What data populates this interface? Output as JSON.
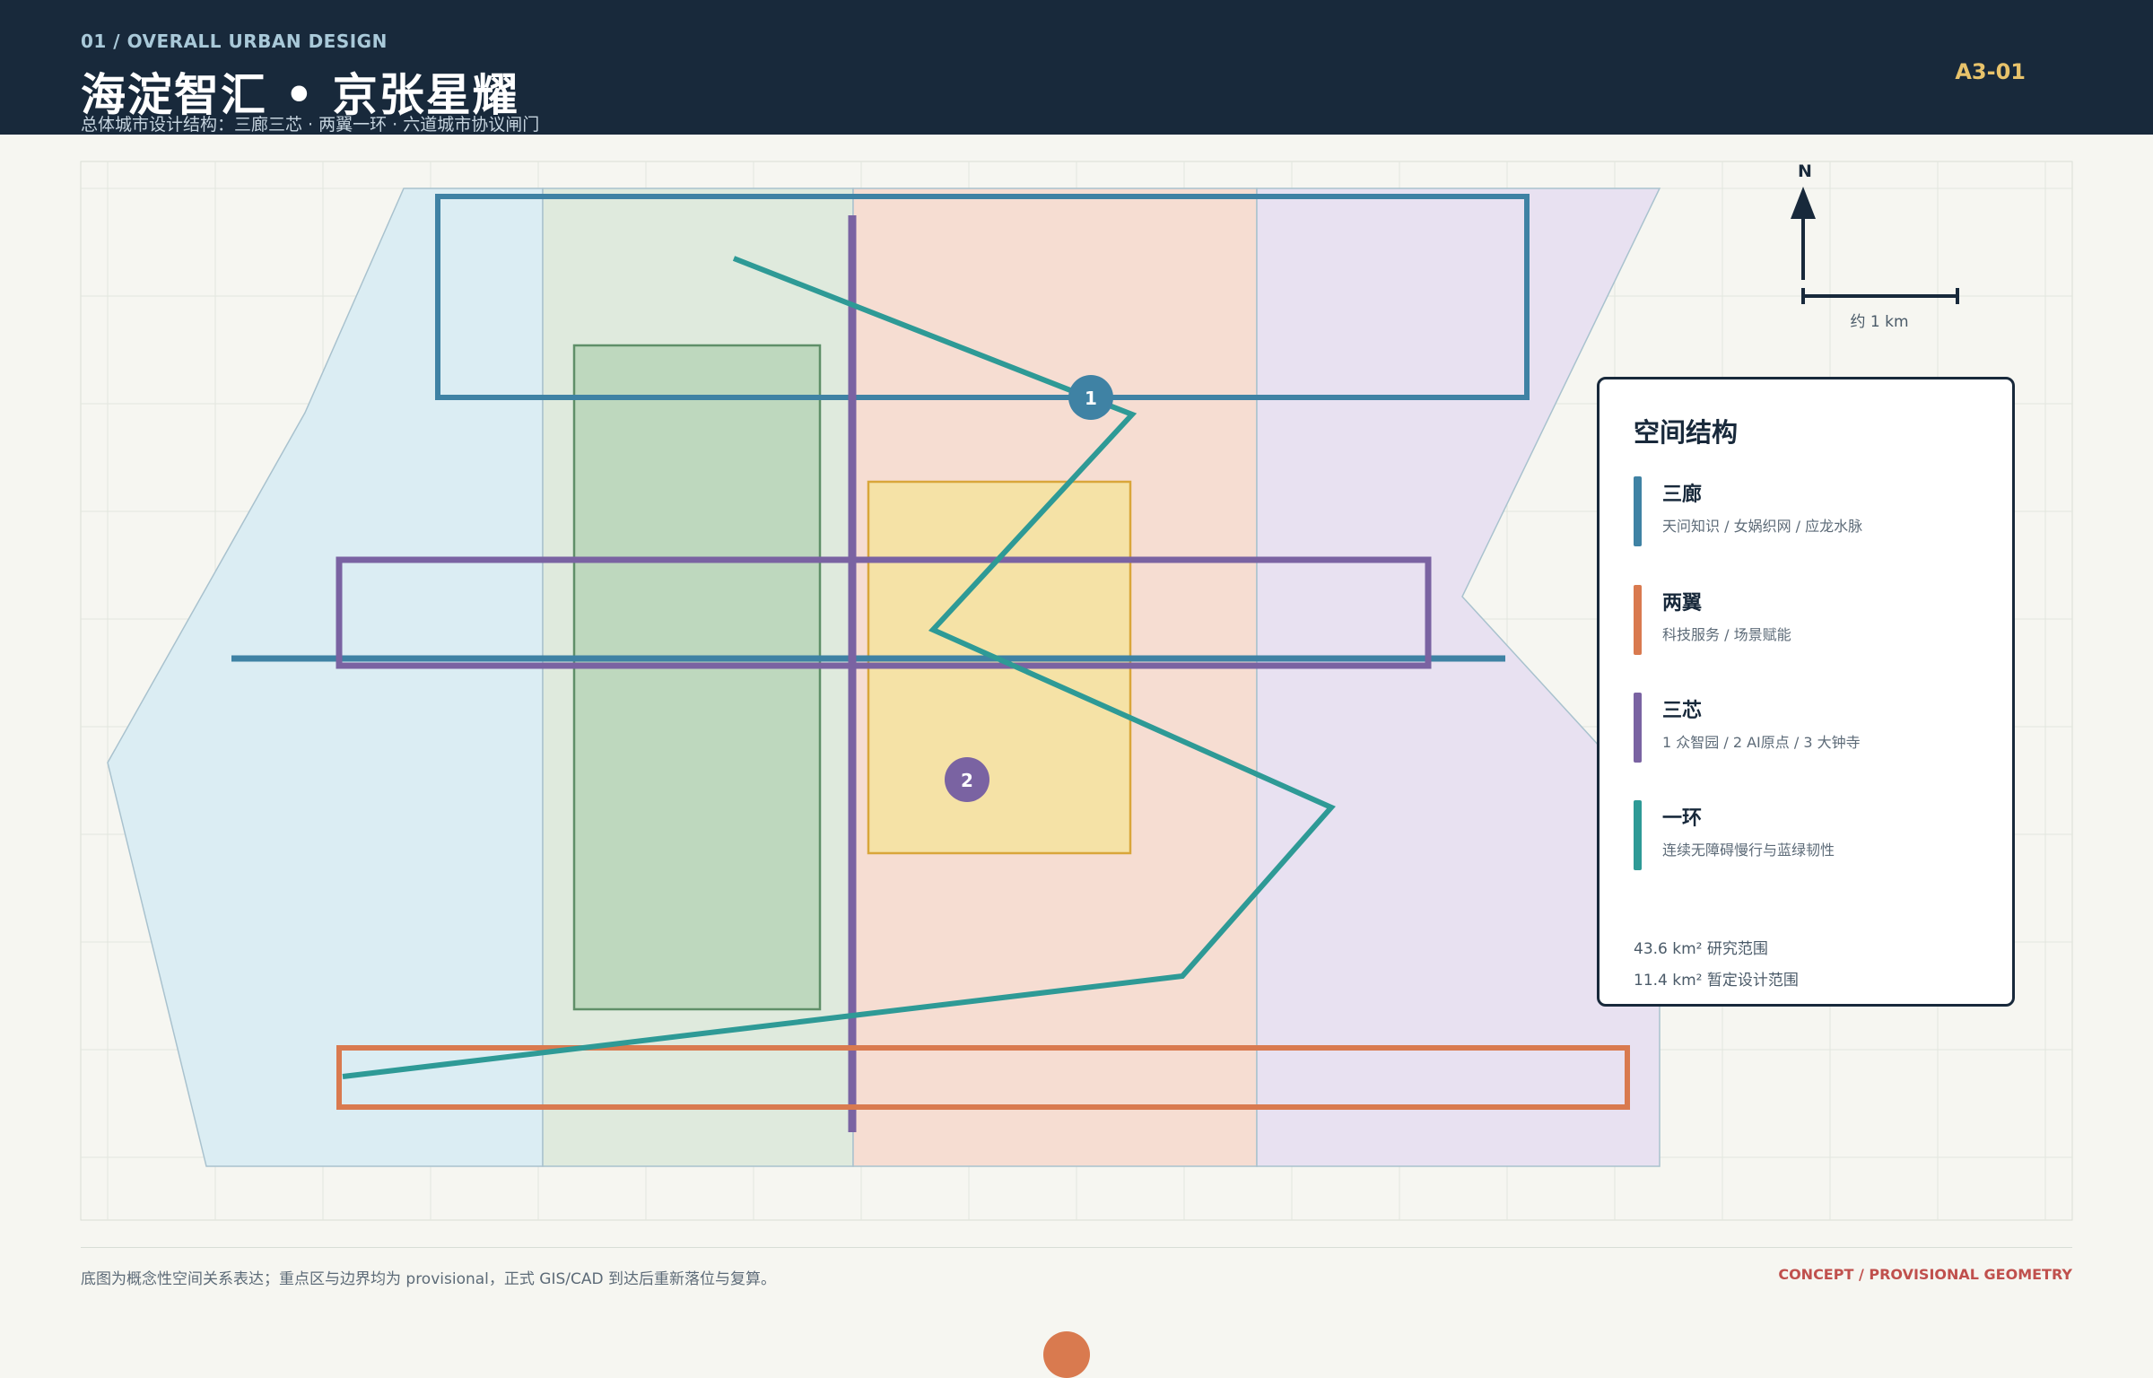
{
  "header": {
    "kicker": "01 / OVERALL URBAN DESIGN",
    "title": "海淀智汇 • 京张星耀",
    "subtitle": "总体城市设计结构：三廊三芯 · 两翼一环 · 六道城市协议闸门",
    "sheet_code": "A3-01"
  },
  "map": {
    "north_label": "N",
    "scale_label": "约 1 km",
    "markers": [
      {
        "label": "1",
        "color": "#3f82a4"
      },
      {
        "label": "2",
        "color": "#7a63a2"
      }
    ],
    "colors": {
      "corridor": "#3f82a4",
      "wing": "#d97a4f",
      "core": "#7a63a2",
      "ring": "#2e9a96",
      "zone_west": "#dbedf3",
      "zone_green": "#dfeadd",
      "zone_peach": "#f6ddd2",
      "zone_lavender": "#e8e1f1",
      "park": "#bed8be",
      "core_block": "#f5e2a6"
    }
  },
  "legend": {
    "title": "空间结构",
    "items": [
      {
        "name": "三廊",
        "desc": "天问知识 / 女娲织网 / 应龙水脉",
        "color": "#3f82a4"
      },
      {
        "name": "两翼",
        "desc": "科技服务 / 场景赋能",
        "color": "#d97a4f"
      },
      {
        "name": "三芯",
        "desc": "1 众智园 / 2 AI原点 / 3 大钟寺",
        "color": "#7a63a2"
      },
      {
        "name": "一环",
        "desc": "连续无障碍慢行与蓝绿韧性",
        "color": "#2e9a96"
      }
    ],
    "stats": [
      "43.6 km² 研究范围",
      "11.4 km² 暂定设计范围"
    ]
  },
  "footer": {
    "note": "底图为概念性空间关系表达；重点区与边界均为 provisional，正式 GIS/CAD 到达后重新落位与复算。",
    "tag": "CONCEPT / PROVISIONAL GEOMETRY"
  }
}
